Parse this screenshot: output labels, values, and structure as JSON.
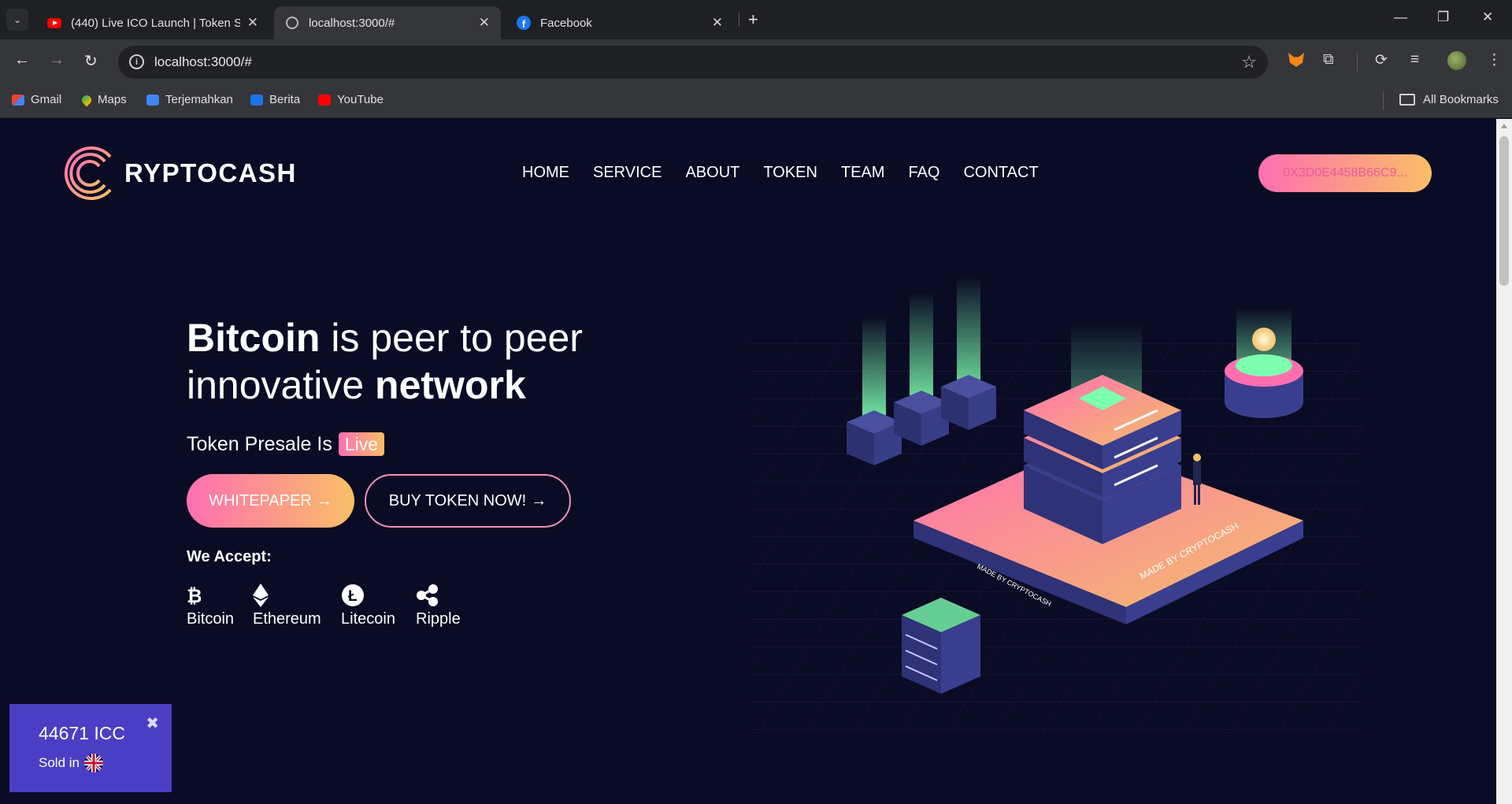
{
  "browser": {
    "tabs": [
      {
        "title": "(440) Live ICO Launch | Token S",
        "icon": "youtube-icon",
        "active": false
      },
      {
        "title": "localhost:3000/#",
        "icon": "globe-icon",
        "active": true
      },
      {
        "title": "Facebook",
        "icon": "facebook-icon",
        "active": false
      }
    ],
    "url": "localhost:3000/#",
    "bookmarks": [
      {
        "label": "Gmail",
        "icon": "gmail-icon"
      },
      {
        "label": "Maps",
        "icon": "maps-icon"
      },
      {
        "label": "Terjemahkan",
        "icon": "translate-icon"
      },
      {
        "label": "Berita",
        "icon": "news-icon"
      },
      {
        "label": "YouTube",
        "icon": "youtube-icon"
      }
    ],
    "all_bookmarks": "All Bookmarks"
  },
  "site": {
    "logo_text": "RYPTOCASH",
    "nav": [
      "HOME",
      "SERVICE",
      "ABOUT",
      "TOKEN",
      "TEAM",
      "FAQ",
      "CONTACT"
    ],
    "wallet_address": "0X3D0E4458B66C9..."
  },
  "hero": {
    "title_bold_1": "Bitcoin",
    "title_rest_1": " is peer to peer",
    "title_rest_2": "innovative ",
    "title_bold_2": "network",
    "presale_text": "Token Presale Is",
    "presale_badge": "Live",
    "whitepaper_button": "WHITEPAPER",
    "buy_button": "BUY TOKEN NOW!",
    "accept_label": "We Accept:",
    "coins": [
      {
        "name": "Bitcoin",
        "icon": "bitcoin-icon"
      },
      {
        "name": "Ethereum",
        "icon": "ethereum-icon"
      },
      {
        "name": "Litecoin",
        "icon": "litecoin-icon"
      },
      {
        "name": "Ripple",
        "icon": "ripple-icon"
      }
    ],
    "illustration_label_1": "MADE BY CRYPTOCASH",
    "illustration_label_2": "MADE BY CRYPTOCASH"
  },
  "sales_popup": {
    "count": "44671 ICC",
    "sold_in": "Sold in",
    "country_flag": "uk-flag-icon"
  },
  "colors": {
    "page_bg": "#0a0b24",
    "accent_pink": "#ff6fb0",
    "accent_gold": "#f9bf66",
    "popup_bg": "#4a3fc4"
  }
}
